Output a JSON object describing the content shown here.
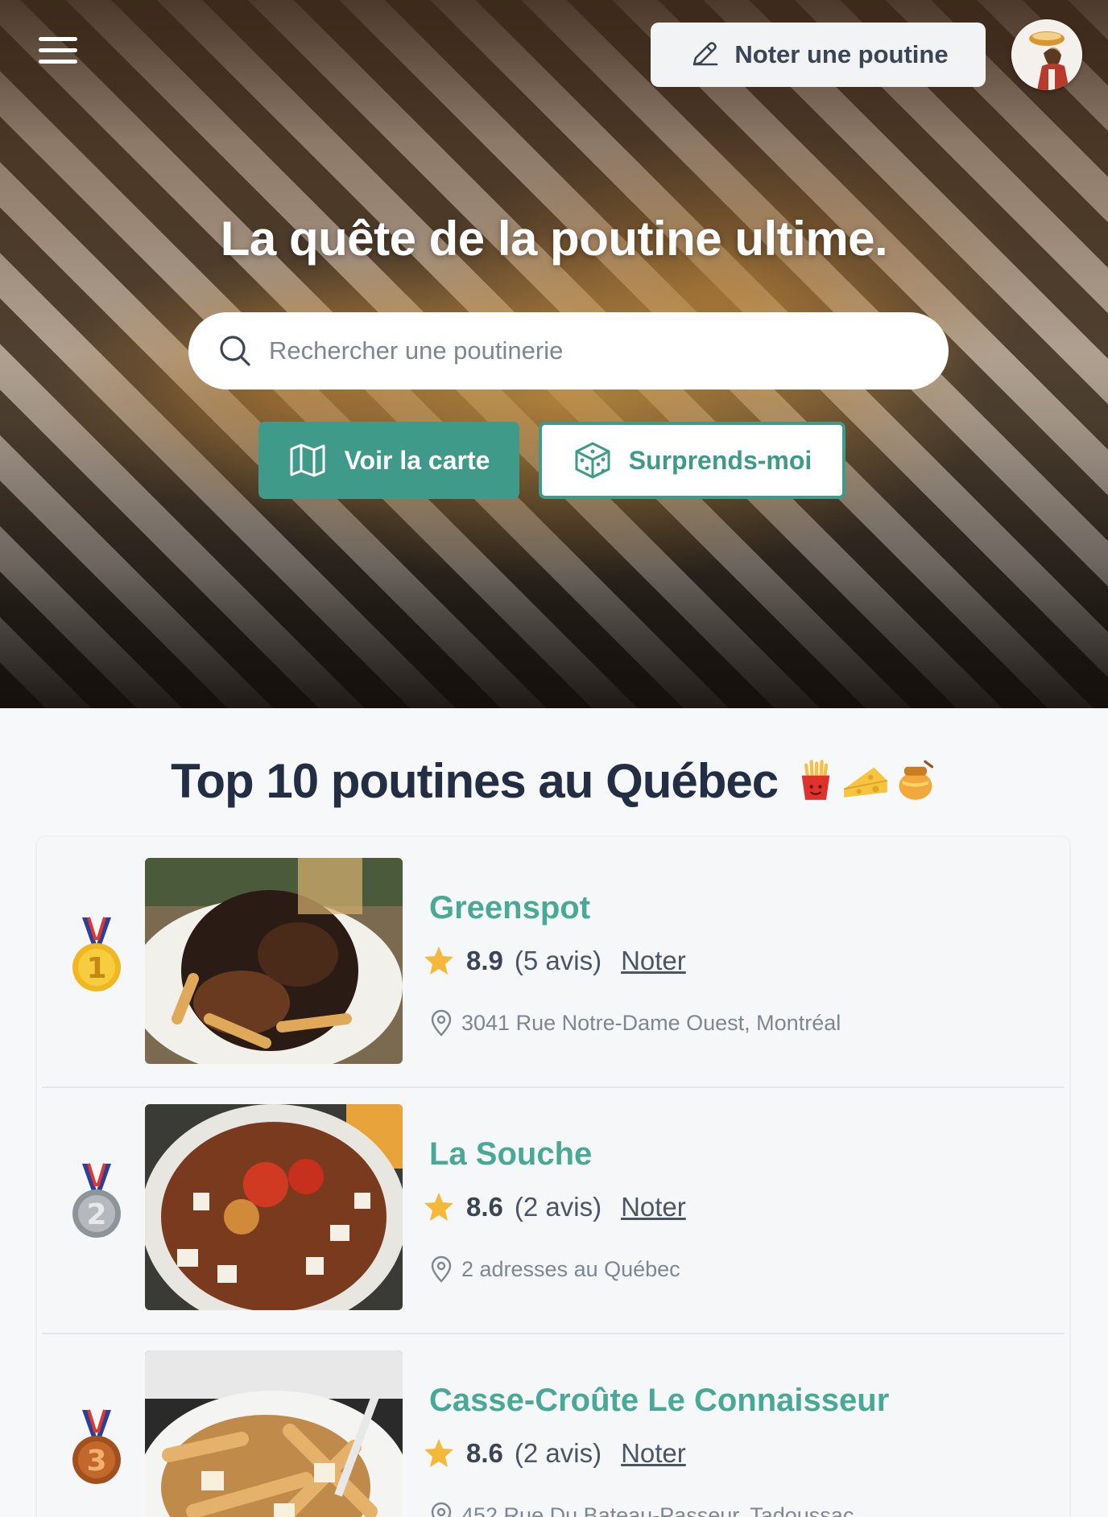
{
  "header": {
    "rate_button_label": "Noter une poutine"
  },
  "hero": {
    "title": "La quête de la poutine ultime.",
    "search_placeholder": "Rechercher une poutinerie",
    "map_button_label": "Voir la carte",
    "surprise_button_label": "Surprends-moi"
  },
  "section": {
    "title": "Top 10 poutines au Québec",
    "emojis": [
      "fries",
      "cheese",
      "honey-pot"
    ]
  },
  "colors": {
    "accent": "#3f9a8a",
    "name_green": "#4aa996",
    "star": "#f5b93a",
    "dark_text": "#232d44"
  },
  "ranking": [
    {
      "rank": "1",
      "medal": "gold",
      "name": "Greenspot",
      "score": "8.9",
      "reviews": "(5 avis)",
      "rate_label": "Noter",
      "address": "3041 Rue Notre-Dame Ouest, Montréal"
    },
    {
      "rank": "2",
      "medal": "silver",
      "name": "La Souche",
      "score": "8.6",
      "reviews": "(2 avis)",
      "rate_label": "Noter",
      "address": "2 adresses au Québec"
    },
    {
      "rank": "3",
      "medal": "bronze",
      "name": "Casse-Croûte Le Connaisseur",
      "score": "8.6",
      "reviews": "(2 avis)",
      "rate_label": "Noter",
      "address": "452 Rue Du Bateau-Passeur, Tadoussac"
    }
  ]
}
